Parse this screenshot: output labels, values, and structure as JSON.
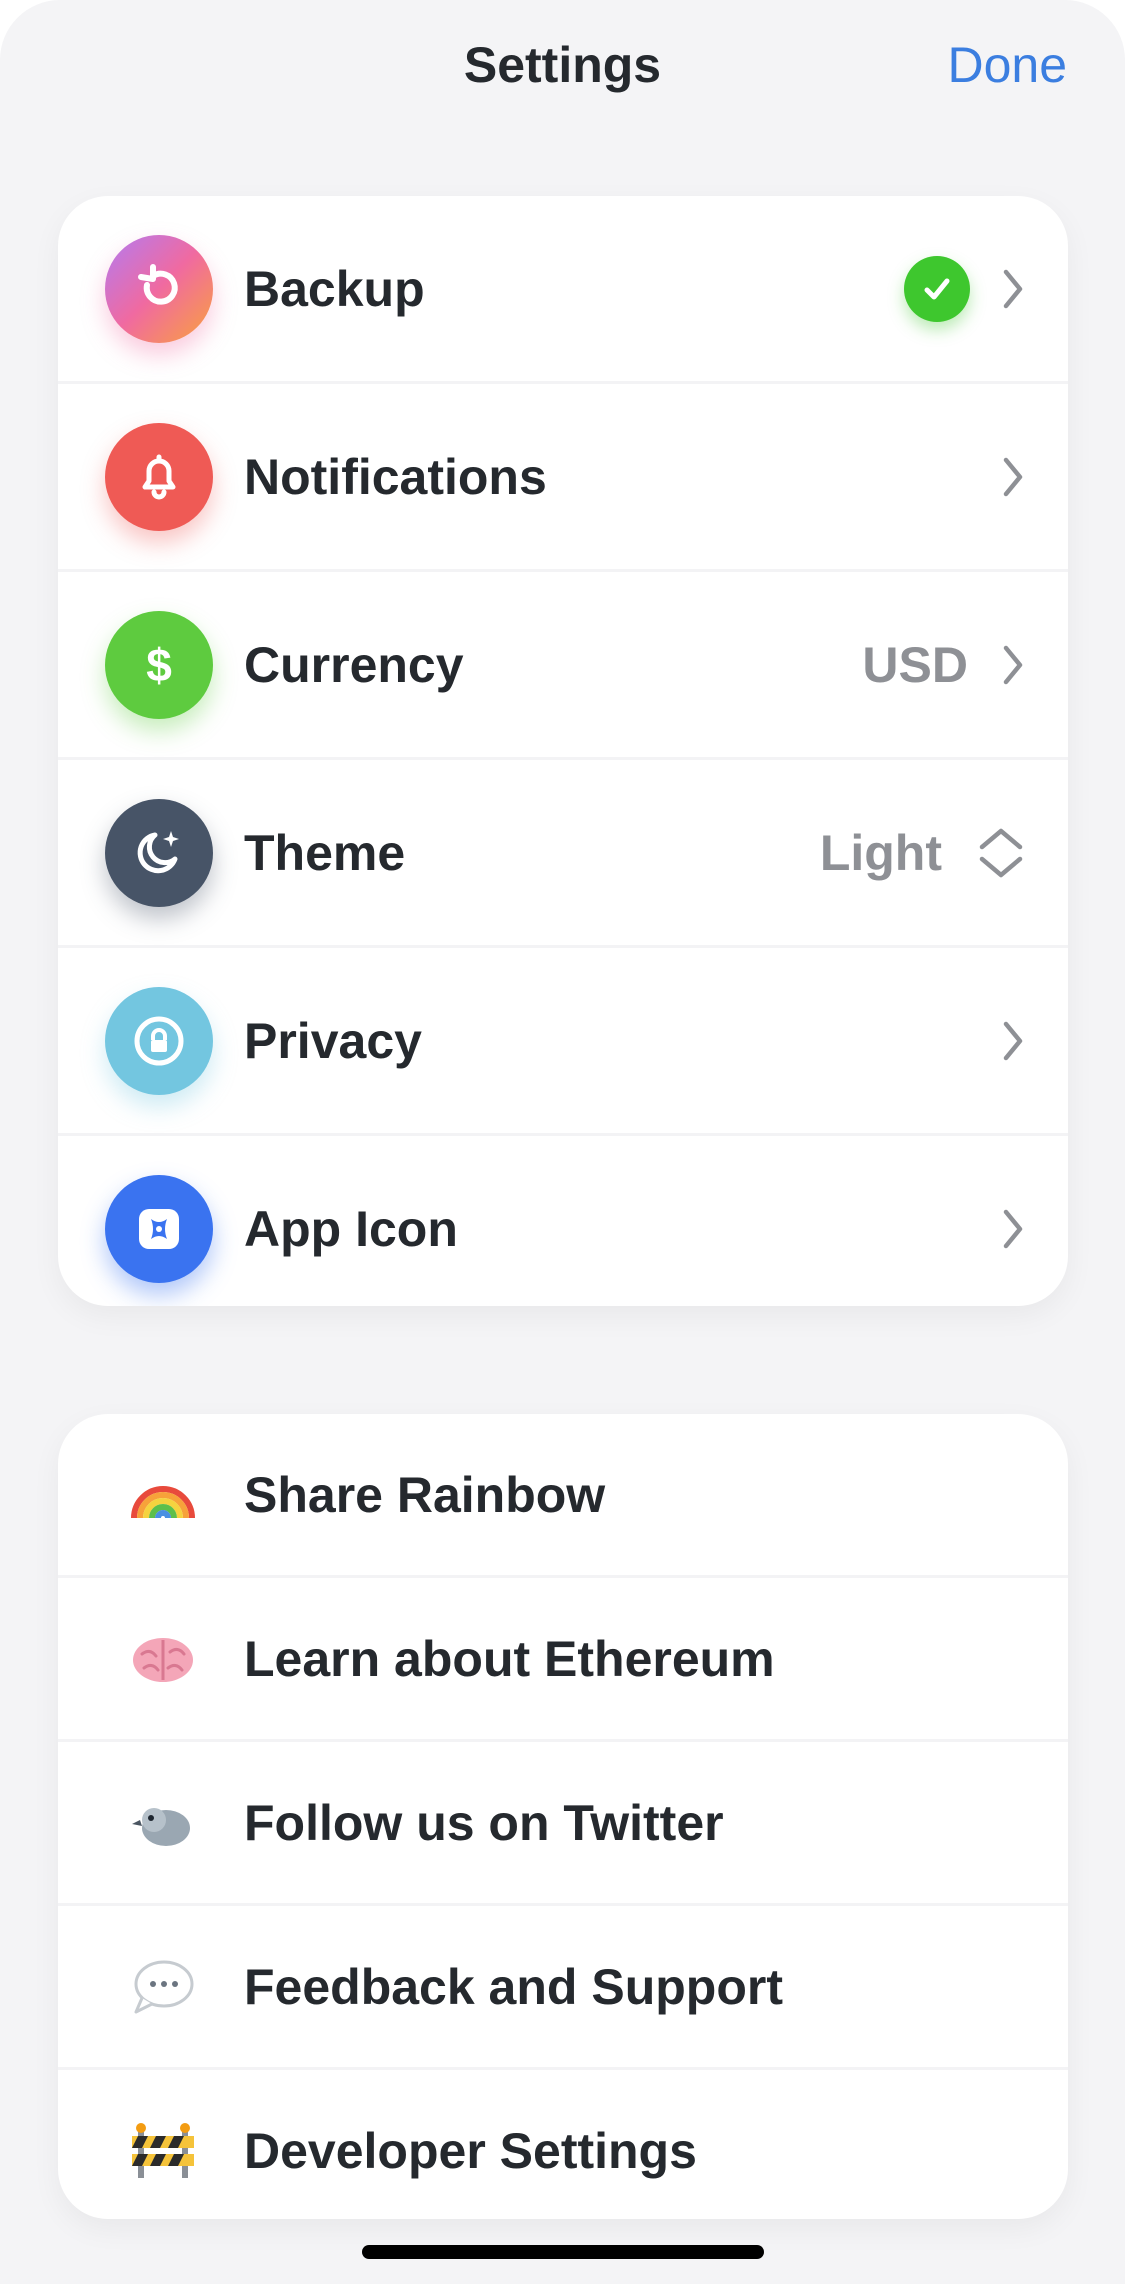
{
  "header": {
    "title": "Settings",
    "done_label": "Done"
  },
  "main_section": [
    {
      "label": "Backup",
      "icon": "backup-icon",
      "status": "check-icon",
      "accessory": "chevron-right-icon"
    },
    {
      "label": "Notifications",
      "icon": "bell-icon",
      "accessory": "chevron-right-icon"
    },
    {
      "label": "Currency",
      "icon": "dollar-icon",
      "value": "USD",
      "accessory": "chevron-right-icon"
    },
    {
      "label": "Theme",
      "icon": "moon-icon",
      "value": "Light",
      "accessory": "up-down-icon"
    },
    {
      "label": "Privacy",
      "icon": "lock-icon",
      "accessory": "chevron-right-icon"
    },
    {
      "label": "App Icon",
      "icon": "app-icon-icon",
      "accessory": "chevron-right-icon"
    }
  ],
  "links_section": [
    {
      "label": "Share Rainbow",
      "icon": "rainbow-icon"
    },
    {
      "label": "Learn about Ethereum",
      "icon": "brain-icon"
    },
    {
      "label": "Follow us on Twitter",
      "icon": "bird-icon"
    },
    {
      "label": "Feedback and Support",
      "icon": "speech-bubble-icon"
    },
    {
      "label": "Developer Settings",
      "icon": "construction-barrier-icon"
    }
  ],
  "colors": {
    "accent": "#3b7ee0",
    "backup": "#f06aa0",
    "notifications": "#ef5a55",
    "currency": "#5ecb3f",
    "theme": "#475467",
    "privacy": "#73c6e0",
    "app_icon": "#3a73f0",
    "check": "#3ec72e"
  }
}
